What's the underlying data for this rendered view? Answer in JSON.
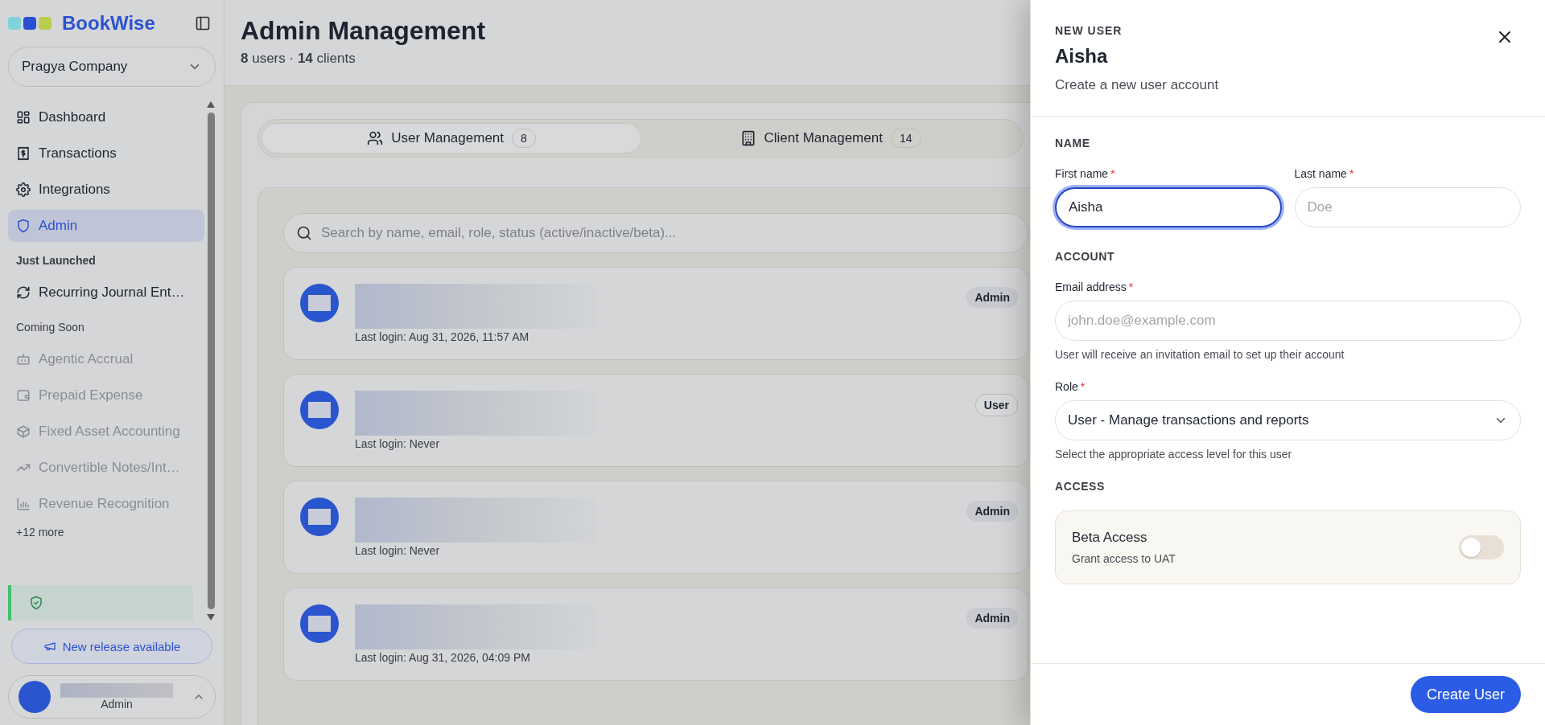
{
  "sidebar": {
    "brand": "BookWise",
    "company": "Pragya Company",
    "groups": [
      {
        "items": [
          {
            "label": "Dashboard",
            "selected": false,
            "disabled": false
          },
          {
            "label": "Transactions",
            "selected": false,
            "disabled": false
          },
          {
            "label": "Integrations",
            "selected": false,
            "disabled": false
          },
          {
            "label": "Admin",
            "selected": true,
            "disabled": false
          }
        ]
      },
      {
        "title": "Just Launched",
        "emphasized": true,
        "items": [
          {
            "label": "Recurring Journal Ent…",
            "selected": false,
            "disabled": false
          }
        ]
      },
      {
        "title": "Coming Soon",
        "emphasized": false,
        "items": [
          {
            "label": "Agentic Accrual",
            "selected": false,
            "disabled": true
          },
          {
            "label": "Prepaid Expense",
            "selected": false,
            "disabled": true
          },
          {
            "label": "Fixed Asset Accounting",
            "selected": false,
            "disabled": true
          },
          {
            "label": "Convertible Notes/Int…",
            "selected": false,
            "disabled": true
          },
          {
            "label": "Revenue Recognition",
            "selected": false,
            "disabled": true
          }
        ]
      }
    ],
    "more": "+12 more",
    "release_button": "New release available",
    "user": {
      "role": "Admin"
    }
  },
  "main": {
    "title": "Admin Management",
    "subtitle": "**8** users · **14** clients",
    "tabs": [
      {
        "label": "User Management",
        "count": "8",
        "selected": true
      },
      {
        "label": "Client Management",
        "count": "14",
        "selected": false
      }
    ],
    "search": {
      "placeholder": "Search by name, email, role, status (active/inactive/beta)..."
    },
    "users": [
      {
        "last_login": "Last login: Aug 31, 2026, 11:57 AM",
        "role": "Admin",
        "kind": "admin"
      },
      {
        "last_login": "Last login: Never",
        "role": "User",
        "kind": "user"
      },
      {
        "last_login": "Last login: Never",
        "role": "Admin",
        "kind": "admin"
      },
      {
        "last_login": "Last login: Aug 31, 2026, 04:09 PM",
        "role": "Admin",
        "kind": "admin"
      }
    ]
  },
  "panel": {
    "eyebrow": "NEW USER",
    "title": "Aisha",
    "subtitle": "Create a new user account",
    "sections": [
      {
        "title": "NAME"
      },
      {
        "title": "ACCOUNT"
      },
      {
        "title": "ACCESS"
      }
    ],
    "first_name": {
      "label": "First name",
      "required_mark": "*",
      "value": "Aisha",
      "focused": true
    },
    "last_name": {
      "label": "Last name",
      "required_mark": "*",
      "placeholder": "Doe",
      "focused": false
    },
    "email": {
      "label": "Email address",
      "required_mark": "*",
      "placeholder": "john.doe@example.com",
      "hint": "User will receive an invitation email to set up their account"
    },
    "role": {
      "label": "Role",
      "required_mark": "*",
      "value": "User - Manage transactions and reports",
      "hint": "Select the appropriate access level for this user"
    },
    "toggle": {
      "label": "Beta Access",
      "description": "Grant access to UAT",
      "on": false
    },
    "submit": "Create User"
  }
}
